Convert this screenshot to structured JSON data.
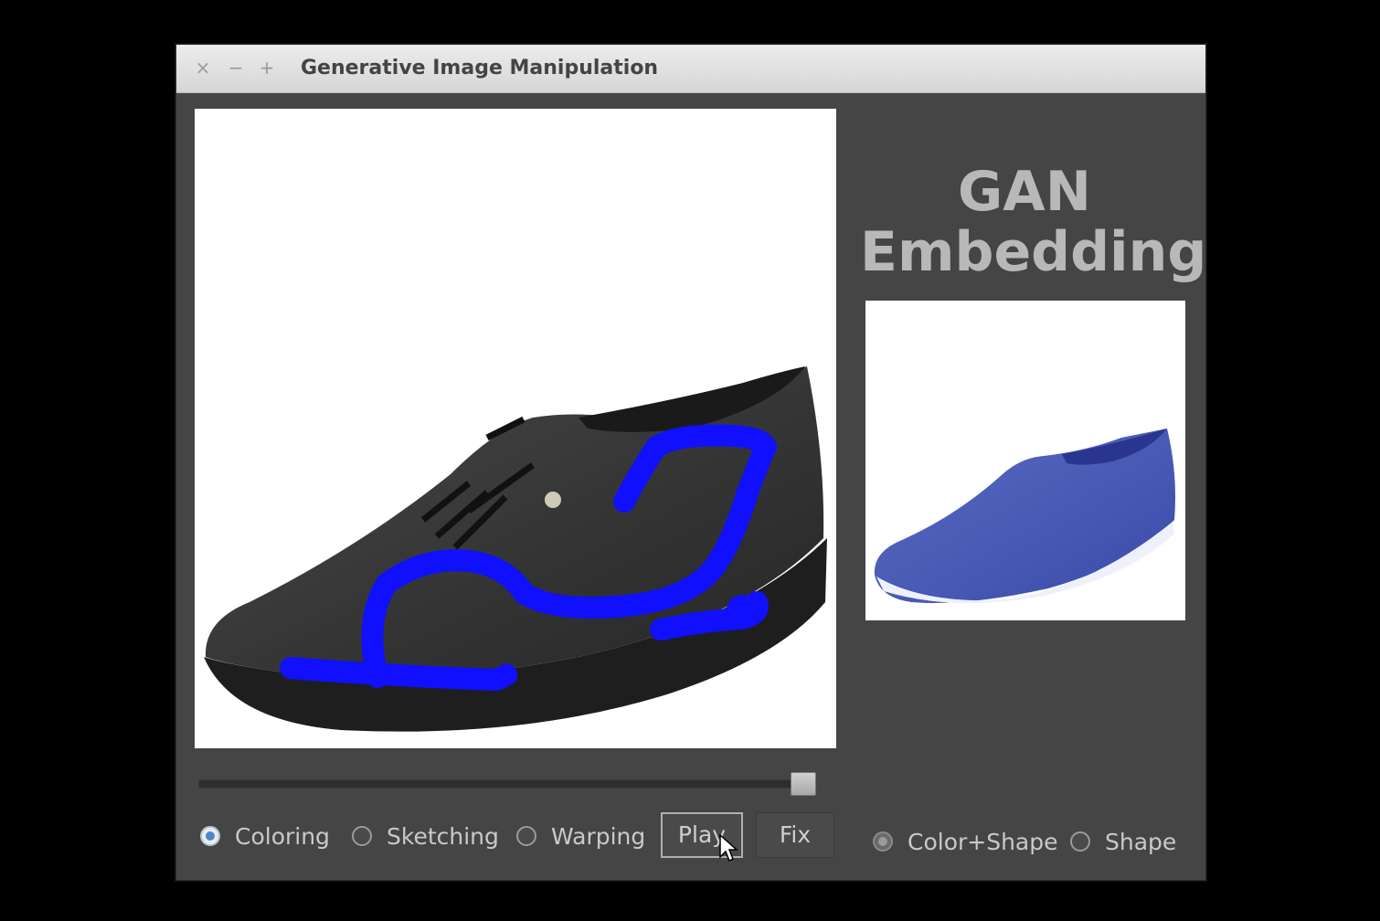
{
  "window": {
    "title": "Generative Image Manipulation",
    "controls": {
      "close": "×",
      "minimize": "−",
      "maximize": "+"
    }
  },
  "canvas": {
    "brush_color": "#1010ff",
    "shoe_color": "#3a3a3a"
  },
  "slider": {
    "value_fraction": 0.97
  },
  "modes": [
    {
      "label": "Coloring",
      "checked": true
    },
    {
      "label": "Sketching",
      "checked": false
    },
    {
      "label": "Warping",
      "checked": false
    }
  ],
  "buttons": {
    "play": "Play",
    "fix": "Fix"
  },
  "right_panel": {
    "title_line1": "GAN",
    "title_line2": "Embedding",
    "preview_shoe_color": "#4a5bb5",
    "options": [
      {
        "label": "Color+Shape",
        "checked": true
      },
      {
        "label": "Shape",
        "checked": false
      }
    ]
  },
  "icons": [
    "close-icon",
    "minimize-icon",
    "maximize-icon",
    "mouse-pointer-icon"
  ]
}
